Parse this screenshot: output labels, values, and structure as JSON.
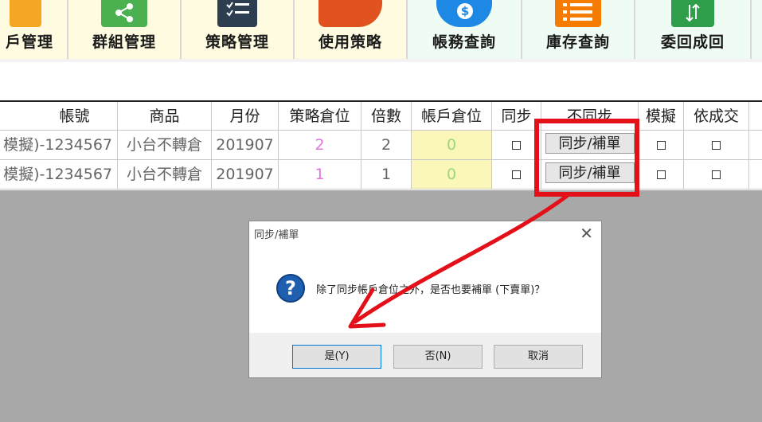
{
  "toolbar": {
    "buttons": [
      {
        "label": "戶管理",
        "color": "#f5a623"
      },
      {
        "label": "群組管理",
        "color": "#4caf50"
      },
      {
        "label": "策略管理",
        "color": "#2d3e50"
      },
      {
        "label": "使用策略",
        "color": "#e0531f"
      },
      {
        "label": "帳務查詢",
        "color": "#1e88e5"
      },
      {
        "label": "庫存查詢",
        "color": "#f57c00"
      },
      {
        "label": "委回成回",
        "color": "#2e9e4a"
      }
    ]
  },
  "grid": {
    "headers": [
      "帳號",
      "商品",
      "月份",
      "策略倉位",
      "倍數",
      "帳戶倉位",
      "同步",
      "不同步",
      "模擬",
      "依成交"
    ],
    "rows": [
      {
        "account": "模擬)-1234567",
        "product": "小台不轉倉",
        "month": "201907",
        "strategy_pos": "2",
        "multiplier": "2",
        "account_pos": "0",
        "sync_button": "同步/補單"
      },
      {
        "account": "模擬)-1234567",
        "product": "小台不轉倉",
        "month": "201907",
        "strategy_pos": "1",
        "multiplier": "1",
        "account_pos": "0",
        "sync_button": "同步/補單"
      }
    ]
  },
  "dialog": {
    "title": "同步/補單",
    "message": "除了同步帳戶倉位之外，是否也要補單 (下賣單)？",
    "buttons": {
      "yes": "是(Y)",
      "no": "否(N)",
      "cancel": "取消"
    }
  },
  "colors": {
    "strategy_pos": "#e075e0",
    "account_pos": "#9ed67a",
    "account_pos_bg": "#fbf6b9",
    "annotation": "#e3101a"
  }
}
